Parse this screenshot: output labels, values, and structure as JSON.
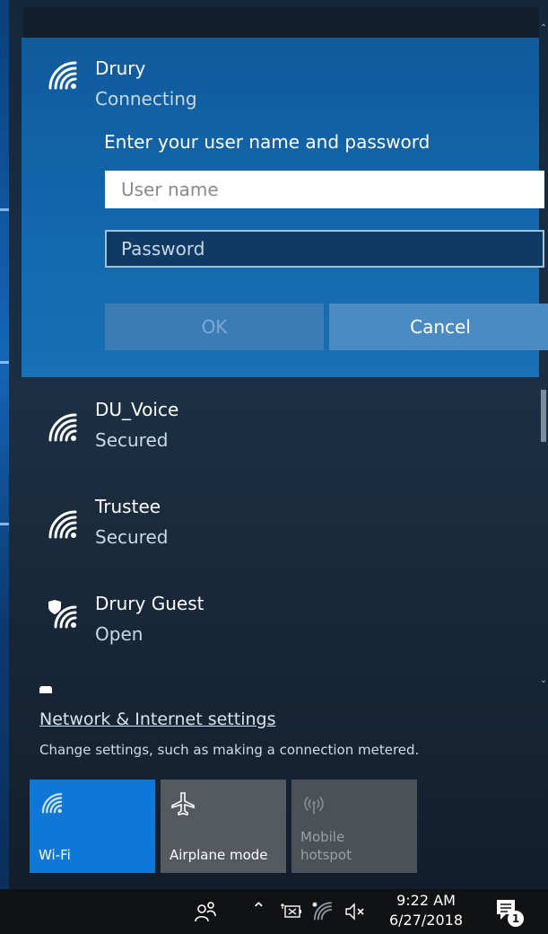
{
  "active_network": {
    "name": "Drury",
    "status": "Connecting",
    "prompt": "Enter your user name and password",
    "username_placeholder": "User name",
    "password_placeholder": "Password",
    "ok_label": "OK",
    "cancel_label": "Cancel"
  },
  "networks": [
    {
      "name": "DU_Voice",
      "status": "Secured",
      "icon": "wifi-icon"
    },
    {
      "name": "Trustee",
      "status": "Secured",
      "icon": "wifi-icon"
    },
    {
      "name": "Drury Guest",
      "status": "Open",
      "icon": "wifi-shield-icon"
    }
  ],
  "settings": {
    "link": "Network & Internet settings",
    "description": "Change settings, such as making a connection metered."
  },
  "quick_actions": [
    {
      "label": "Wi-Fi",
      "icon": "wifi-icon",
      "state": "on"
    },
    {
      "label": "Airplane mode",
      "icon": "airplane-icon",
      "state": "off"
    },
    {
      "label": "Mobile hotspot",
      "icon": "hotspot-icon",
      "state": "disabled"
    }
  ],
  "taskbar": {
    "time": "9:22 AM",
    "date": "6/27/2018",
    "notification_count": "1"
  },
  "colors": {
    "accent": "#0f78d6",
    "active_card": "#1468ad",
    "taskbar": "#101214"
  }
}
